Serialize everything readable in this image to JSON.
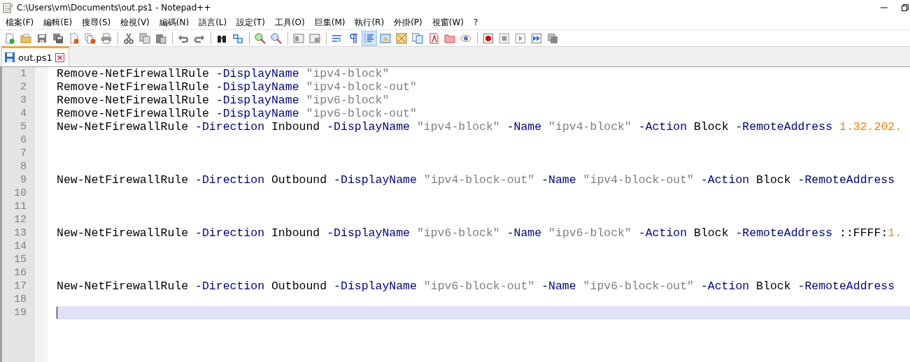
{
  "window": {
    "title": "C:\\Users\\vm\\Documents\\out.ps1 - Notepad++"
  },
  "menu": [
    "檔案(F)",
    "編輯(E)",
    "搜尋(S)",
    "檢視(V)",
    "編碼(N)",
    "語言(L)",
    "設定(T)",
    "工具(O)",
    "巨集(M)",
    "執行(R)",
    "外掛(P)",
    "視窗(W)",
    "?"
  ],
  "toolbar": [
    {
      "pressed": false
    },
    {
      "pressed": false
    },
    {
      "pressed": false
    },
    {
      "pressed": false
    },
    {
      "pressed": false
    },
    {
      "pressed": false
    },
    {
      "pressed": false
    },
    {
      "pressed": false
    },
    {
      "pressed": false
    },
    {
      "pressed": false
    },
    {
      "pressed": false
    },
    {
      "pressed": false
    },
    {
      "pressed": false
    },
    {
      "pressed": false
    },
    {
      "pressed": false
    },
    {
      "pressed": false
    },
    {
      "pressed": false
    },
    {
      "pressed": false
    },
    {
      "pressed": false
    },
    {
      "pressed": false
    },
    {
      "pressed": true
    },
    {
      "pressed": false
    },
    {
      "pressed": false
    },
    {
      "pressed": false
    },
    {
      "pressed": false
    },
    {
      "pressed": false
    },
    {
      "pressed": false
    },
    {
      "pressed": false
    },
    {
      "pressed": false
    },
    {
      "pressed": false
    },
    {
      "pressed": false
    },
    {
      "pressed": false
    }
  ],
  "tabs": [
    {
      "label": "out.ps1",
      "selected": true
    }
  ],
  "editor": {
    "lines": [
      {
        "number": "1",
        "current": false,
        "tokens": [
          {
            "kind": "word",
            "text": "Remove-NetFirewallRule"
          },
          {
            "kind": "param",
            "text": " -DisplayName"
          },
          {
            "kind": "string",
            "text": " \"ipv4-block\""
          }
        ]
      },
      {
        "number": "2",
        "current": false,
        "tokens": [
          {
            "kind": "word",
            "text": "Remove-NetFirewallRule"
          },
          {
            "kind": "param",
            "text": " -DisplayName"
          },
          {
            "kind": "string",
            "text": " \"ipv4-block-out\""
          }
        ]
      },
      {
        "number": "3",
        "current": false,
        "tokens": [
          {
            "kind": "word",
            "text": "Remove-NetFirewallRule"
          },
          {
            "kind": "param",
            "text": " -DisplayName"
          },
          {
            "kind": "string",
            "text": " \"ipv6-block\""
          }
        ]
      },
      {
        "number": "4",
        "current": false,
        "tokens": [
          {
            "kind": "word",
            "text": "Remove-NetFirewallRule"
          },
          {
            "kind": "param",
            "text": " -DisplayName"
          },
          {
            "kind": "string",
            "text": " \"ipv6-block-out\""
          }
        ]
      },
      {
        "number": "5",
        "current": false,
        "tokens": [
          {
            "kind": "word",
            "text": "New-NetFirewallRule"
          },
          {
            "kind": "param",
            "text": " -Direction"
          },
          {
            "kind": "word",
            "text": " Inbound"
          },
          {
            "kind": "param",
            "text": " -DisplayName"
          },
          {
            "kind": "string",
            "text": " \"ipv4-block\""
          },
          {
            "kind": "param",
            "text": " -Name"
          },
          {
            "kind": "string",
            "text": " \"ipv4-block\""
          },
          {
            "kind": "param",
            "text": " -Action"
          },
          {
            "kind": "word",
            "text": " Block"
          },
          {
            "kind": "param",
            "text": " -RemoteAddress"
          },
          {
            "kind": "number",
            "text": " 1.32.202."
          }
        ]
      },
      {
        "number": "6",
        "current": false
      },
      {
        "number": "7",
        "current": false
      },
      {
        "number": "8",
        "current": false
      },
      {
        "number": "9",
        "current": false,
        "tokens": [
          {
            "kind": "word",
            "text": "New-NetFirewallRule"
          },
          {
            "kind": "param",
            "text": " -Direction"
          },
          {
            "kind": "word",
            "text": " Outbound"
          },
          {
            "kind": "param",
            "text": " -DisplayName"
          },
          {
            "kind": "string",
            "text": " \"ipv4-block-out\""
          },
          {
            "kind": "param",
            "text": " -Name"
          },
          {
            "kind": "string",
            "text": " \"ipv4-block-out\""
          },
          {
            "kind": "param",
            "text": " -Action"
          },
          {
            "kind": "word",
            "text": " Block"
          },
          {
            "kind": "param",
            "text": " -RemoteAddress"
          }
        ]
      },
      {
        "number": "10",
        "current": false
      },
      {
        "number": "11",
        "current": false
      },
      {
        "number": "12",
        "current": false
      },
      {
        "number": "13",
        "current": false,
        "tokens": [
          {
            "kind": "word",
            "text": "New-NetFirewallRule"
          },
          {
            "kind": "param",
            "text": " -Direction"
          },
          {
            "kind": "word",
            "text": " Inbound"
          },
          {
            "kind": "param",
            "text": " -DisplayName"
          },
          {
            "kind": "string",
            "text": " \"ipv6-block\""
          },
          {
            "kind": "param",
            "text": " -Name"
          },
          {
            "kind": "string",
            "text": " \"ipv6-block\""
          },
          {
            "kind": "param",
            "text": " -Action"
          },
          {
            "kind": "word",
            "text": " Block"
          },
          {
            "kind": "param",
            "text": " -RemoteAddress"
          },
          {
            "kind": "word",
            "text": " ::FFFF:"
          },
          {
            "kind": "number",
            "text": "1."
          }
        ]
      },
      {
        "number": "14",
        "current": false
      },
      {
        "number": "15",
        "current": false
      },
      {
        "number": "16",
        "current": false
      },
      {
        "number": "17",
        "current": false,
        "tokens": [
          {
            "kind": "word",
            "text": "New-NetFirewallRule"
          },
          {
            "kind": "param",
            "text": " -Direction"
          },
          {
            "kind": "word",
            "text": " Outbound"
          },
          {
            "kind": "param",
            "text": " -DisplayName"
          },
          {
            "kind": "string",
            "text": " \"ipv6-block-out\""
          },
          {
            "kind": "param",
            "text": " -Name"
          },
          {
            "kind": "string",
            "text": " \"ipv6-block-out\""
          },
          {
            "kind": "param",
            "text": " -Action"
          },
          {
            "kind": "word",
            "text": " Block"
          },
          {
            "kind": "param",
            "text": " -RemoteAddress"
          }
        ]
      },
      {
        "number": "18",
        "current": false
      },
      {
        "number": "19",
        "current": true
      }
    ]
  }
}
